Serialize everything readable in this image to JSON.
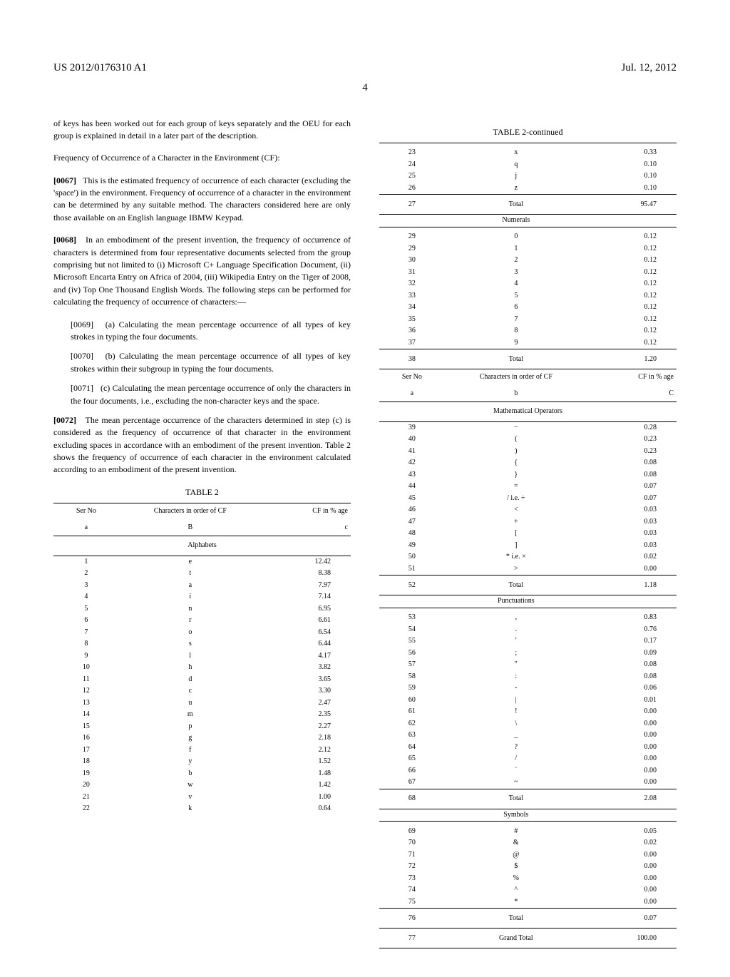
{
  "pub_number": "US 2012/0176310 A1",
  "pub_date": "Jul. 12, 2012",
  "page_number": "4",
  "p0066_tail": "of keys has been worked out for each group of keys separately and the OEU for each group is explained in detail in a later part of the description.",
  "cf_heading": "Frequency of Occurrence of a Character in the Environment (CF):",
  "p0067_num": "[0067]",
  "p0067": "This is the estimated frequency of occurrence of each character (excluding the 'space') in the environment. Frequency of occurrence of a character in the environment can be determined by any suitable method. The characters considered here are only those available on an English language IBMW Keypad.",
  "p0068_num": "[0068]",
  "p0068": "In an embodiment of the present invention, the frequency of occurrence of characters is determined from four representative documents selected from the group comprising but not limited to (i) Microsoft C+ Language Specification Document, (ii) Microsoft Encarta Entry on Africa of 2004, (iii) Wikipedia Entry on the Tiger of 2008, and (iv) Top One Thousand English Words. The following steps can be performed for calculating the frequency of occurrence of characters:—",
  "p0069_num": "[0069]",
  "p0069": "(a) Calculating the mean percentage occurrence of all types of key strokes in typing the four documents.",
  "p0070_num": "[0070]",
  "p0070": "(b) Calculating the mean percentage occurrence of all types of key strokes within their subgroup in typing the four documents.",
  "p0071_num": "[0071]",
  "p0071": "(c) Calculating the mean percentage occurrence of only the characters in the four documents, i.e., excluding the non-character keys and the space.",
  "p0072_num": "[0072]",
  "p0072": "The mean percentage occurrence of the characters determined in step (c) is considered as the frequency of occurrence of that character in the environment excluding spaces in accordance with an embodiment of the present invention. Table 2 shows the frequency of occurrence of each character in the environment calculated according to an embodiment of the present invention.",
  "table2_caption": "TABLE 2",
  "table2c_caption": "TABLE 2-continued",
  "th_serno1": "Ser No",
  "th_serno2": "a",
  "th_char1": "Characters in order of CF",
  "th_char2_B": "B",
  "th_char2_b": "b",
  "th_cf1": "CF in % age",
  "th_cf2_c": "c",
  "th_cf2_C": "C",
  "sec_alphabets": "Alphabets",
  "sec_numerals": "Numerals",
  "sec_mathops": "Mathematical Operators",
  "sec_punct": "Punctuations",
  "sec_symbols": "Symbols",
  "total_label": "Total",
  "grand_total_label": "Grand Total",
  "chart_data": {
    "type": "table",
    "title": "TABLE 2 — Frequency of Occurrence of Characters (CF in % age)",
    "columns": [
      "Ser No",
      "Characters in order of CF",
      "CF in % age"
    ],
    "sections": [
      {
        "name": "Alphabets",
        "rows": [
          [
            "1",
            "e",
            "12.42"
          ],
          [
            "2",
            "t",
            "8.38"
          ],
          [
            "3",
            "a",
            "7.97"
          ],
          [
            "4",
            "i",
            "7.14"
          ],
          [
            "5",
            "n",
            "6.95"
          ],
          [
            "6",
            "r",
            "6.61"
          ],
          [
            "7",
            "o",
            "6.54"
          ],
          [
            "8",
            "s",
            "6.44"
          ],
          [
            "9",
            "l",
            "4.17"
          ],
          [
            "10",
            "h",
            "3.82"
          ],
          [
            "11",
            "d",
            "3.65"
          ],
          [
            "12",
            "c",
            "3.30"
          ],
          [
            "13",
            "u",
            "2.47"
          ],
          [
            "14",
            "m",
            "2.35"
          ],
          [
            "15",
            "p",
            "2.27"
          ],
          [
            "16",
            "g",
            "2.18"
          ],
          [
            "17",
            "f",
            "2.12"
          ],
          [
            "18",
            "y",
            "1.52"
          ],
          [
            "19",
            "b",
            "1.48"
          ],
          [
            "20",
            "w",
            "1.42"
          ],
          [
            "21",
            "v",
            "1.00"
          ],
          [
            "22",
            "k",
            "0.64"
          ],
          [
            "23",
            "x",
            "0.33"
          ],
          [
            "24",
            "q",
            "0.10"
          ],
          [
            "25",
            "j",
            "0.10"
          ],
          [
            "26",
            "z",
            "0.10"
          ]
        ],
        "total": [
          "27",
          "Total",
          "95.47"
        ]
      },
      {
        "name": "Numerals",
        "rows": [
          [
            "29",
            "0",
            "0.12"
          ],
          [
            "29",
            "1",
            "0.12"
          ],
          [
            "30",
            "2",
            "0.12"
          ],
          [
            "31",
            "3",
            "0.12"
          ],
          [
            "32",
            "4",
            "0.12"
          ],
          [
            "33",
            "5",
            "0.12"
          ],
          [
            "34",
            "6",
            "0.12"
          ],
          [
            "35",
            "7",
            "0.12"
          ],
          [
            "36",
            "8",
            "0.12"
          ],
          [
            "37",
            "9",
            "0.12"
          ]
        ],
        "total": [
          "38",
          "Total",
          "1.20"
        ]
      },
      {
        "name": "Mathematical Operators",
        "rows": [
          [
            "39",
            "−",
            "0.28"
          ],
          [
            "40",
            "(",
            "0.23"
          ],
          [
            "41",
            ")",
            "0.23"
          ],
          [
            "42",
            "{",
            "0.08"
          ],
          [
            "43",
            "}",
            "0.08"
          ],
          [
            "44",
            "=",
            "0.07"
          ],
          [
            "45",
            "/ i.e. ÷",
            "0.07"
          ],
          [
            "46",
            "<",
            "0.03"
          ],
          [
            "47",
            "+",
            "0.03"
          ],
          [
            "48",
            "[",
            "0.03"
          ],
          [
            "49",
            "]",
            "0.03"
          ],
          [
            "50",
            "* i.e. ×",
            "0.02"
          ],
          [
            "51",
            ">",
            "0.00"
          ]
        ],
        "total": [
          "52",
          "Total",
          "1.18"
        ]
      },
      {
        "name": "Punctuations",
        "rows": [
          [
            "53",
            ",",
            "0.83"
          ],
          [
            "54",
            ".",
            "0.76"
          ],
          [
            "55",
            "'",
            "0.17"
          ],
          [
            "56",
            ";",
            "0.09"
          ],
          [
            "57",
            "\"",
            "0.08"
          ],
          [
            "58",
            ":",
            "0.08"
          ],
          [
            "59",
            "-",
            "0.06"
          ],
          [
            "60",
            "|",
            "0.01"
          ],
          [
            "61",
            "!",
            "0.00"
          ],
          [
            "62",
            "\\",
            "0.00"
          ],
          [
            "63",
            "_",
            "0.00"
          ],
          [
            "64",
            "?",
            "0.00"
          ],
          [
            "65",
            "/",
            "0.00"
          ],
          [
            "66",
            "`",
            "0.00"
          ],
          [
            "67",
            "~",
            "0.00"
          ]
        ],
        "total": [
          "68",
          "Total",
          "2.08"
        ]
      },
      {
        "name": "Symbols",
        "rows": [
          [
            "69",
            "#",
            "0.05"
          ],
          [
            "70",
            "&",
            "0.02"
          ],
          [
            "71",
            "@",
            "0.00"
          ],
          [
            "72",
            "$",
            "0.00"
          ],
          [
            "73",
            "%",
            "0.00"
          ],
          [
            "74",
            "^",
            "0.00"
          ],
          [
            "75",
            "*",
            "0.00"
          ]
        ],
        "total": [
          "76",
          "Total",
          "0.07"
        ]
      }
    ],
    "grand_total": [
      "77",
      "Grand Total",
      "100.00"
    ]
  }
}
